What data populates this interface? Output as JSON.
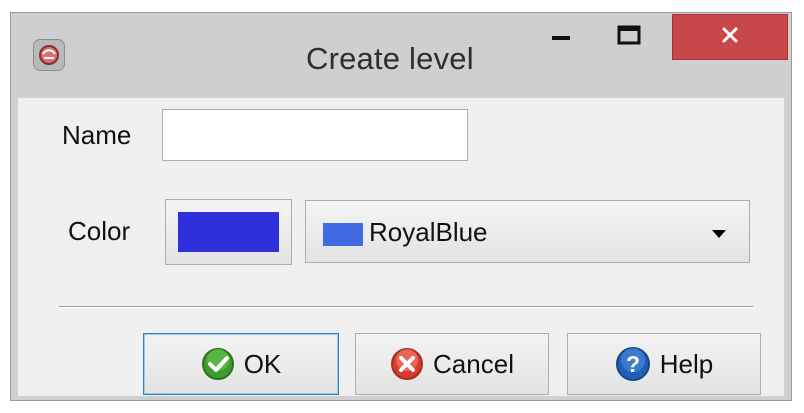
{
  "window": {
    "title": "Create level"
  },
  "titlebar": {
    "app_icon": "app-icon",
    "minimize_icon": "minimize-icon",
    "maximize_icon": "maximize-icon",
    "close_icon": "close-icon"
  },
  "form": {
    "name_label": "Name",
    "name_value": "",
    "name_placeholder": "",
    "color_label": "Color",
    "color_hex": "#2f2fdb",
    "color_select": {
      "value": "RoyalBlue",
      "swatch_hex": "#4169e1"
    }
  },
  "buttons": {
    "ok_label": "OK",
    "cancel_label": "Cancel",
    "help_label": "Help"
  },
  "icons": {
    "ok": "check-icon",
    "cancel": "cancel-icon",
    "help": "help-icon",
    "dropdown": "chevron-down-icon"
  },
  "colors": {
    "close_button": "#c8484a",
    "ok_icon": "#3f9b2f",
    "cancel_icon": "#d73b2f",
    "help_icon": "#1f5fb8"
  }
}
